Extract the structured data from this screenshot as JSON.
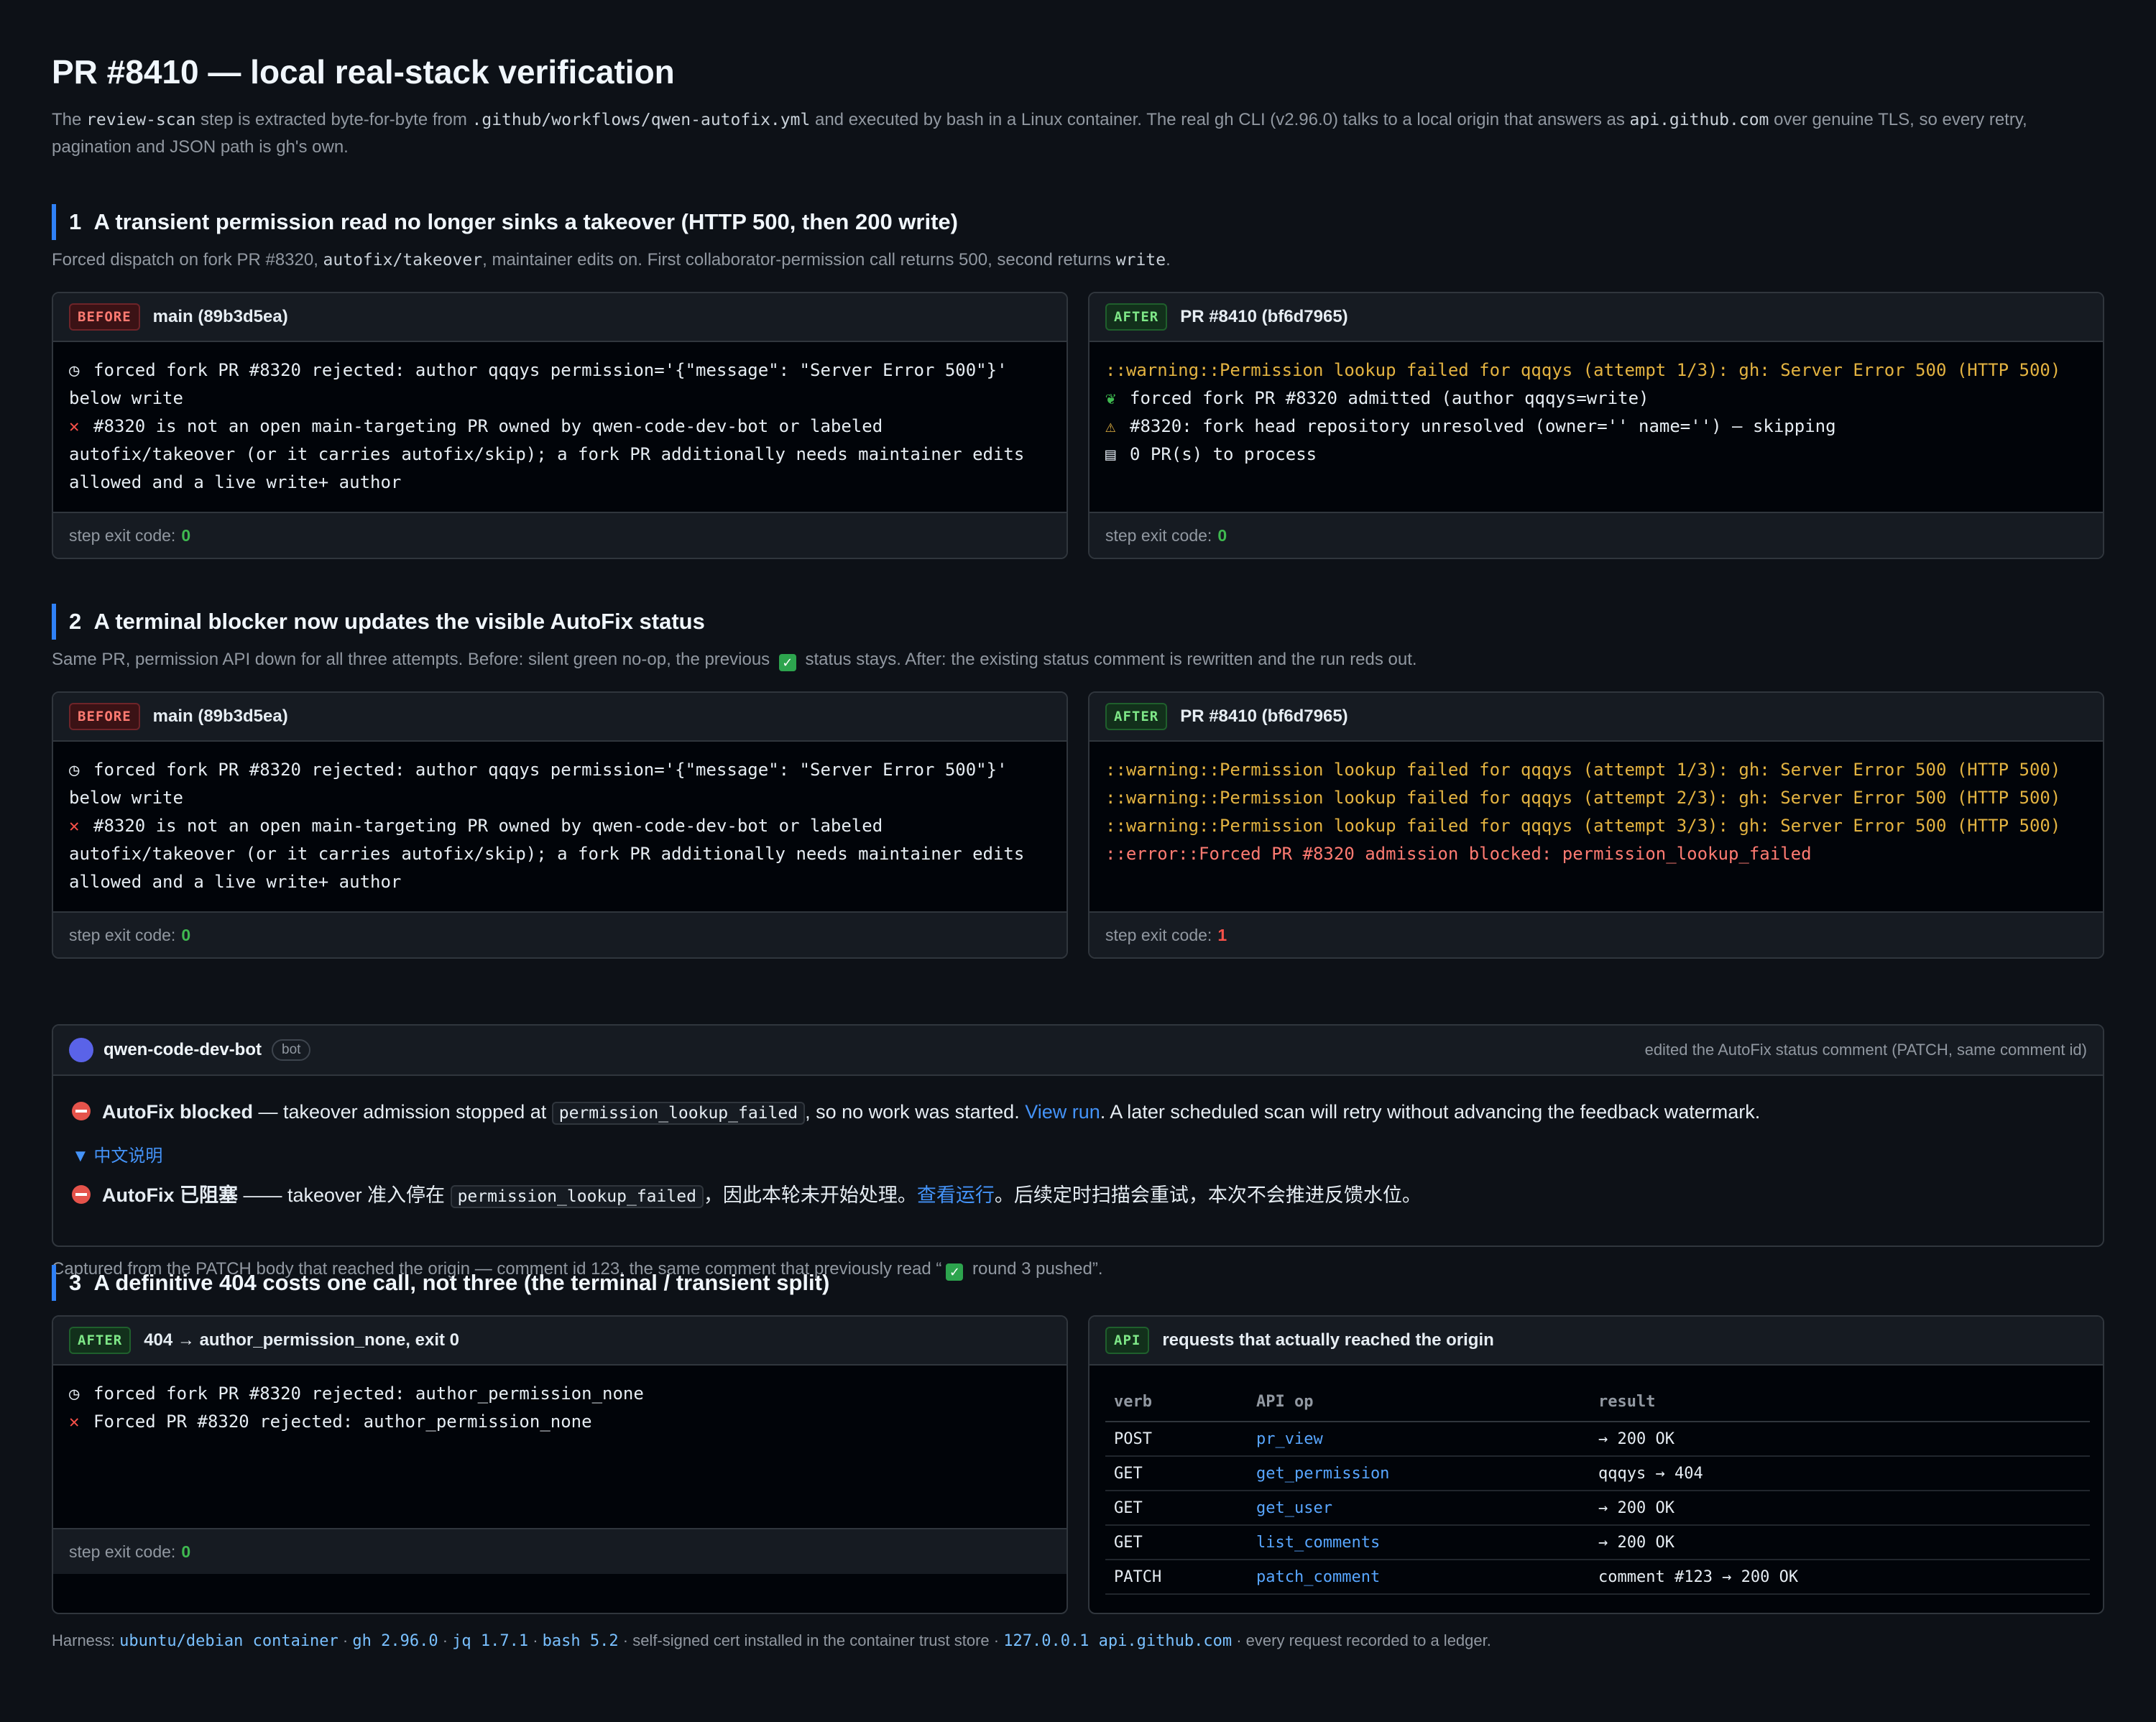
{
  "title": "PR #8410 — local real-stack verification",
  "intro": {
    "t1": "The ",
    "c1": "review-scan",
    "t2": " step is extracted byte-for-byte from ",
    "c2": ".github/workflows/qwen-autofix.yml",
    "t3": " and executed by bash in a Linux container. The real gh CLI (v2.96.0) talks to a local origin that answers as ",
    "c3": "api.github.com",
    "t4": " over genuine TLS, so every retry, pagination and JSON path is gh's own."
  },
  "section1": {
    "number": "1",
    "heading": "A transient permission read no longer sinks a takeover (HTTP 500, then 200 write)",
    "sub_t1": "Forced dispatch on fork PR #8320, ",
    "sub_c1": "autofix/takeover",
    "sub_t2": ", maintainer edits on. First collaborator-permission call returns 500, second returns ",
    "sub_c2": "write",
    "sub_t3": ".",
    "before": {
      "badge": "BEFORE",
      "label": "main (89b3d5ea)",
      "line1": "forced fork PR #8320 rejected: author qqqys permission='{\"message\": \"Server Error 500\"}' below write",
      "line2": "#8320 is not an open main-targeting PR owned by qwen-code-dev-bot or labeled autofix/takeover (or it carries autofix/skip); a fork PR additionally needs maintainer edits allowed and a live write+ author",
      "exit_label": "step exit code:",
      "exit_code": "0"
    },
    "after": {
      "badge": "AFTER",
      "label": "PR #8410 (bf6d7965)",
      "line1": "::warning::Permission lookup failed for qqqys (attempt 1/3): gh: Server Error 500 (HTTP 500)",
      "line2": "forced fork PR #8320 admitted (author qqqys=write)",
      "line3": "#8320: fork head repository unresolved (owner='' name='') — skipping",
      "line4": "0 PR(s) to process",
      "exit_label": "step exit code:",
      "exit_code": "0"
    }
  },
  "section2": {
    "number": "2",
    "heading": "A terminal blocker now updates the visible AutoFix status",
    "sub_t1": "Same PR, permission API down for all three attempts. Before: silent green no-op, the previous ",
    "sub_t2": " status stays. After: the existing status comment is rewritten and the run reds out.",
    "before": {
      "badge": "BEFORE",
      "label": "main (89b3d5ea)",
      "line1": "forced fork PR #8320 rejected: author qqqys permission='{\"message\": \"Server Error 500\"}' below write",
      "line2": "#8320 is not an open main-targeting PR owned by qwen-code-dev-bot or labeled autofix/takeover (or it carries autofix/skip); a fork PR additionally needs maintainer edits allowed and a live write+ author",
      "exit_label": "step exit code:",
      "exit_code": "0"
    },
    "after": {
      "badge": "AFTER",
      "label": "PR #8410 (bf6d7965)",
      "line1": "::warning::Permission lookup failed for qqqys (attempt 1/3): gh: Server Error 500 (HTTP 500)",
      "line2": "::warning::Permission lookup failed for qqqys (attempt 2/3): gh: Server Error 500 (HTTP 500)",
      "line3": "::warning::Permission lookup failed for qqqys (attempt 3/3): gh: Server Error 500 (HTTP 500)",
      "line4": "::error::Forced PR #8320 admission blocked: permission_lookup_failed",
      "exit_label": "step exit code:",
      "exit_code": "1"
    },
    "comment": {
      "user": "qwen-code-dev-bot",
      "bot_tag": "bot",
      "note": "edited the AutoFix status comment (PATCH, same comment id)",
      "en_bold": "AutoFix blocked",
      "en_t1": " — takeover admission stopped at ",
      "en_code": "permission_lookup_failed",
      "en_t2": ", so no work was started. ",
      "en_link": "View run",
      "en_t3": ". A later scheduled scan will retry without advancing the feedback watermark.",
      "details": "▼ 中文说明",
      "zh_bold": "AutoFix 已阻塞",
      "zh_t1": " —— takeover 准入停在 ",
      "zh_code": "permission_lookup_failed",
      "zh_t2": "，因此本轮未开始处理。",
      "zh_link": "查看运行",
      "zh_t3": "。后续定时扫描会重试，本次不会推进反馈水位。"
    },
    "caption_t1": "Captured from the PATCH body that reached the origin — comment id 123, the same comment that previously read “",
    "caption_t2": " round 3 pushed”."
  },
  "section3": {
    "number": "3",
    "heading": "A definitive 404 costs one call, not three (the terminal / transient split)",
    "after": {
      "badge": "AFTER",
      "label": "404 → author_permission_none, exit 0",
      "line1": "forced fork PR #8320 rejected: author_permission_none",
      "line2": "Forced PR #8320 rejected: author_permission_none",
      "exit_label": "step exit code:",
      "exit_code": "0"
    },
    "api": {
      "badge": "API",
      "label": "requests that actually reached the origin",
      "headers": [
        "verb",
        "API op",
        "result"
      ],
      "rows": [
        {
          "verb": "POST",
          "op": "pr_view",
          "result": "→ 200 OK"
        },
        {
          "verb": "GET",
          "op": "get_permission",
          "result": "qqqys → 404"
        },
        {
          "verb": "GET",
          "op": "get_user",
          "result": "→ 200 OK"
        },
        {
          "verb": "GET",
          "op": "list_comments",
          "result": "→ 200 OK"
        },
        {
          "verb": "PATCH",
          "op": "patch_comment",
          "result": "comment #123 → 200 OK"
        }
      ]
    }
  },
  "harness": {
    "label": "Harness: ",
    "h1": "ubuntu/debian container",
    "h2": "gh 2.96.0",
    "h3": "jq 1.7.1",
    "h4": "bash 5.2",
    "t1": " · self-signed cert installed in the container trust store · ",
    "h5": "127.0.0.1 api.github.com",
    "t2": " · every request recorded to a ledger.",
    "sep": " · "
  },
  "icons": {
    "stopwatch": "stopwatch-icon",
    "cross": "cross-mark-icon",
    "seedling": "seedling-icon",
    "warning": "warning-icon",
    "clipboard": "clipboard-icon",
    "no-entry": "no-entry-icon",
    "check": "check-mark-icon"
  },
  "colors": {
    "accent": "#2f81f7",
    "ok": "#3fb950",
    "fail": "#f85149",
    "warn": "#e3b341",
    "link": "#4493f8"
  }
}
